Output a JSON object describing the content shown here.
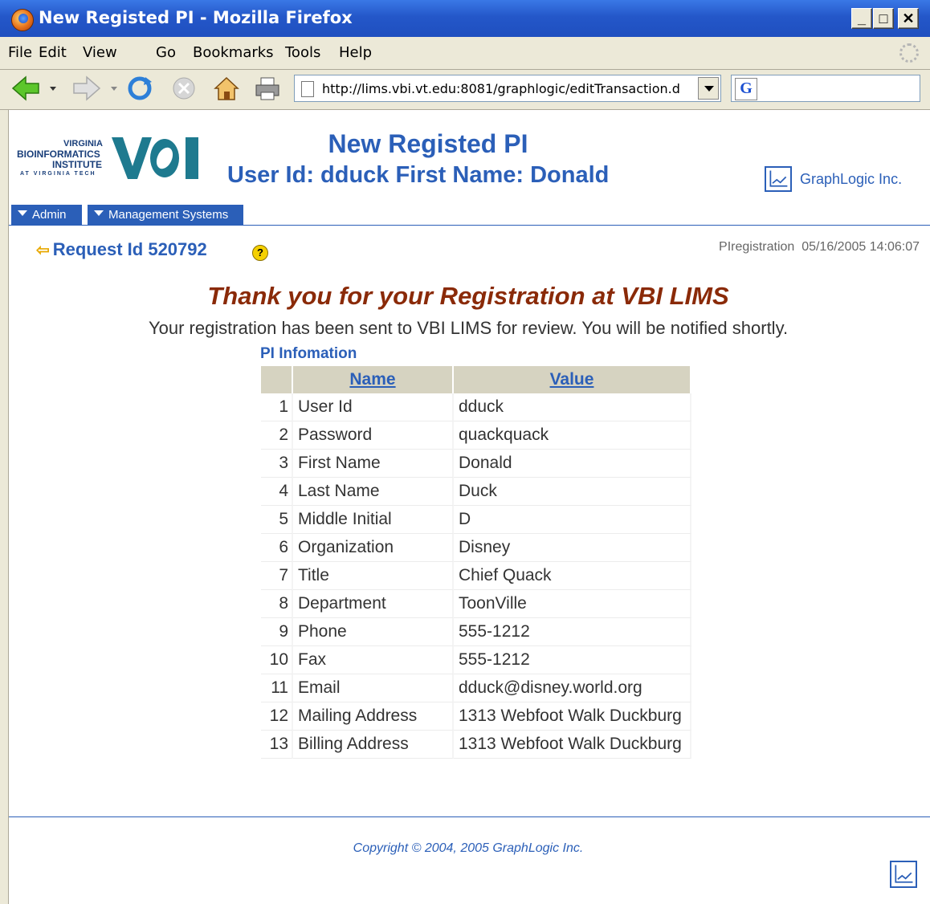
{
  "window": {
    "title": "New Registed PI - Mozilla Firefox"
  },
  "menu": [
    "File",
    "Edit",
    "View",
    "Go",
    "Bookmarks",
    "Tools",
    "Help"
  ],
  "address": {
    "url": "http://lims.vbi.vt.edu:8081/graphlogic/editTransaction.d"
  },
  "logo": {
    "line1": "VIRGINIA",
    "line2": "BIOINFORMATICS",
    "line3": "INSTITUTE",
    "line4": "AT VIRGINIA TECH",
    "mark": "VBI"
  },
  "header": {
    "title": "New Registed PI",
    "subtitle": "User Id: dduck First Name: Donald",
    "company": "GraphLogic Inc."
  },
  "nav": {
    "admin": "Admin",
    "management": "Management Systems"
  },
  "request": {
    "label": "Request Id 520792",
    "help": "?",
    "module": "PIregistration",
    "timestamp": "05/16/2005 14:06:07"
  },
  "message": {
    "thanks": "Thank you for your Registration at VBI LIMS",
    "body": "Your registration has been sent to VBI LIMS for review. You will be notified shortly."
  },
  "pi": {
    "section": "PI Infomation",
    "columns": {
      "name": "Name",
      "value": "Value"
    },
    "rows": [
      {
        "num": "1",
        "name": "User Id",
        "value": "dduck"
      },
      {
        "num": "2",
        "name": "Password",
        "value": "quackquack"
      },
      {
        "num": "3",
        "name": "First Name",
        "value": "Donald"
      },
      {
        "num": "4",
        "name": "Last Name",
        "value": "Duck"
      },
      {
        "num": "5",
        "name": "Middle Initial",
        "value": "D"
      },
      {
        "num": "6",
        "name": "Organization",
        "value": "Disney"
      },
      {
        "num": "7",
        "name": "Title",
        "value": "Chief Quack"
      },
      {
        "num": "8",
        "name": "Department",
        "value": "ToonVille"
      },
      {
        "num": "9",
        "name": "Phone",
        "value": "555-1212"
      },
      {
        "num": "10",
        "name": "Fax",
        "value": "555-1212"
      },
      {
        "num": "11",
        "name": "Email",
        "value": "dduck@disney.world.org"
      },
      {
        "num": "12",
        "name": "Mailing Address",
        "value": "1313 Webfoot Walk Duckburg"
      },
      {
        "num": "13",
        "name": "Billing Address",
        "value": "1313 Webfoot Walk Duckburg"
      }
    ]
  },
  "footer": {
    "copyright": "Copyright © 2004, 2005 GraphLogic Inc."
  }
}
